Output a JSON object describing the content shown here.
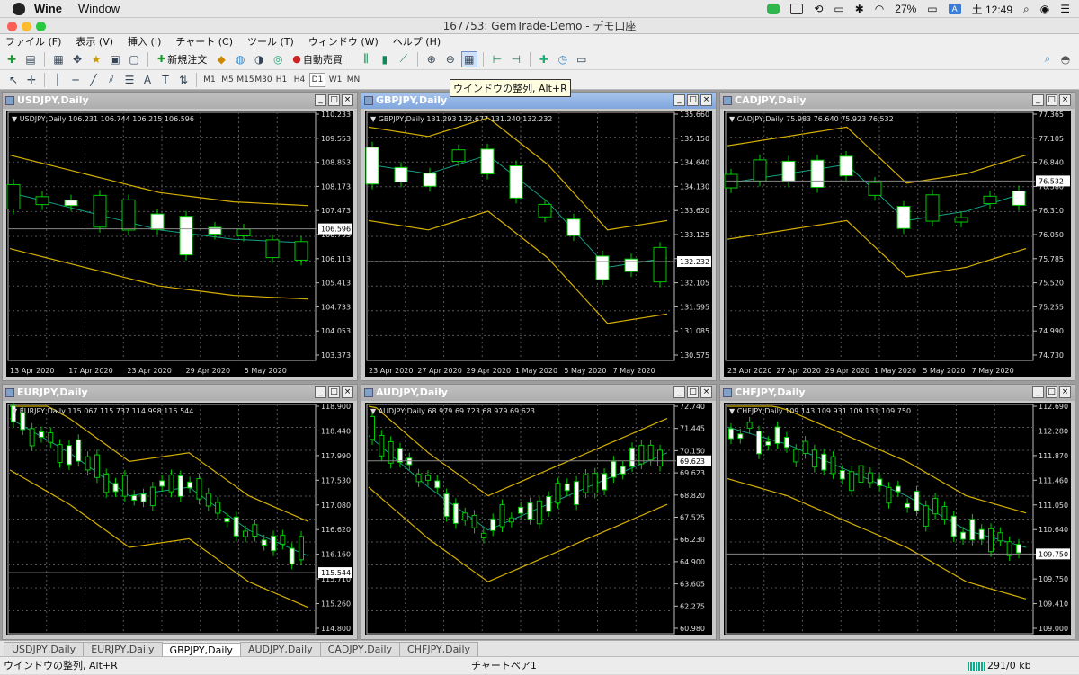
{
  "mac_menubar": {
    "app": "Wine",
    "window_menu": "Window",
    "battery": "27%",
    "ime": "A",
    "clock": "土 12:49"
  },
  "window_title": "167753: GemTrade-Demo - デモ口座",
  "menu": [
    "ファイル (F)",
    "表示 (V)",
    "挿入 (I)",
    "チャート (C)",
    "ツール (T)",
    "ウィンドウ (W)",
    "ヘルプ (H)"
  ],
  "toolbar": {
    "new_order": "新規注文",
    "auto_trading": "自動売買"
  },
  "timeframes": [
    "M1",
    "M5",
    "M15",
    "M30",
    "H1",
    "H4",
    "D1",
    "W1",
    "MN"
  ],
  "selected_timeframe": "D1",
  "tooltip": "ウインドウの整列, Alt+R",
  "charts": [
    {
      "title": "USDJPY,Daily",
      "info": "USDJPY,Daily  106.231 106.744 106.215 106.596",
      "yticks": [
        "110.233",
        "109.553",
        "108.853",
        "108.173",
        "107.473",
        "106.793",
        "106.113",
        "105.413",
        "104.733",
        "104.053",
        "103.373"
      ],
      "price_label": "106.596",
      "xticks": [
        "13 Apr 2020",
        "17 Apr 2020",
        "23 Apr 2020",
        "29 Apr 2020",
        "5 May 2020"
      ]
    },
    {
      "title": "GBPJPY,Daily",
      "info": "GBPJPY,Daily  131.293 132.677 131.240 132.232",
      "yticks": [
        "135.660",
        "135.150",
        "134.640",
        "134.130",
        "133.620",
        "133.125",
        "132.615",
        "132.105",
        "131.595",
        "131.085",
        "130.575"
      ],
      "price_label": "132.232",
      "xticks": [
        "23 Apr 2020",
        "27 Apr 2020",
        "29 Apr 2020",
        "1 May 2020",
        "5 May 2020",
        "7 May 2020"
      ]
    },
    {
      "title": "CADJPY,Daily",
      "info": "CADJPY,Daily  75.983 76.640 75.923 76.532",
      "yticks": [
        "77.365",
        "77.105",
        "76.840",
        "76.580",
        "76.310",
        "76.050",
        "75.785",
        "75.520",
        "75.255",
        "74.990",
        "74.730"
      ],
      "price_label": "76.532",
      "xticks": [
        "23 Apr 2020",
        "27 Apr 2020",
        "29 Apr 2020",
        "1 May 2020",
        "5 May 2020",
        "7 May 2020"
      ]
    },
    {
      "title": "EURJPY,Daily",
      "info": "EURJPY,Daily  115.067 115.737 114.998 115.544",
      "yticks": [
        "118.900",
        "118.440",
        "117.990",
        "117.530",
        "117.080",
        "116.620",
        "116.160",
        "115.710",
        "115.260",
        "114.800"
      ],
      "price_label": "115.544",
      "xticks": []
    },
    {
      "title": "AUDJPY,Daily",
      "info": "AUDJPY,Daily  68.979 69.723 68.979 69.623",
      "yticks": [
        "72.740",
        "71.445",
        "70.150",
        "69.623",
        "68.820",
        "67.525",
        "66.230",
        "64.900",
        "63.605",
        "62.275",
        "60.980"
      ],
      "price_label": "69.623",
      "xticks": []
    },
    {
      "title": "CHFJPY,Daily",
      "info": "CHFJPY,Daily  109.143 109.931 109.131 109.750",
      "yticks": [
        "112.690",
        "112.280",
        "111.870",
        "111.460",
        "111.050",
        "110.640",
        "110.230",
        "109.750",
        "109.410",
        "109.000"
      ],
      "price_label": "109.750",
      "xticks": []
    }
  ],
  "tabs": [
    "USDJPY,Daily",
    "EURJPY,Daily",
    "GBPJPY,Daily",
    "AUDJPY,Daily",
    "CADJPY,Daily",
    "CHFJPY,Daily"
  ],
  "selected_tab": "GBPJPY,Daily",
  "status": {
    "left": "ウインドウの整列, Alt+R",
    "profile": "チャートペア1",
    "traffic": "291/0 kb"
  }
}
